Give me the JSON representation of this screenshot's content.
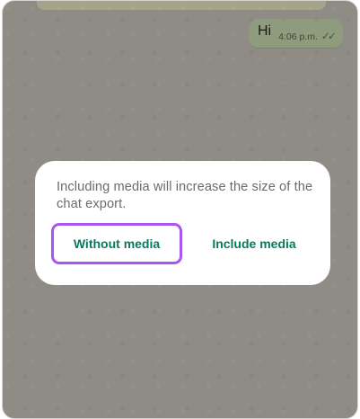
{
  "chat": {
    "message_text": "Hi",
    "message_time": "4:06 p.m.",
    "status_icon": "double-check-icon"
  },
  "dialog": {
    "message": "Including media will increase the size of the chat export.",
    "without_media_label": "Without media",
    "include_media_label": "Include media"
  },
  "colors": {
    "accent": "#087a5f",
    "focus_ring": "#a855f7",
    "dim_background": "#8f8b85",
    "outgoing_bubble": "#8e9b7c"
  }
}
